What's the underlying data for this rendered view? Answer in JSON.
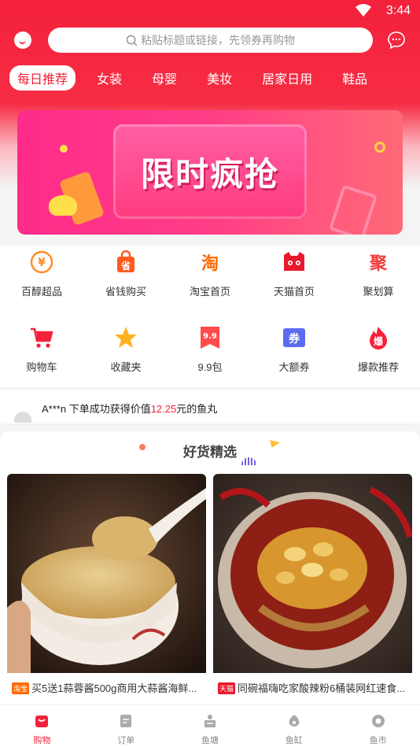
{
  "status": {
    "time": "3:44"
  },
  "search": {
    "placeholder": "粘贴标题或链接，先领券再购物"
  },
  "categories": [
    "每日推荐",
    "女装",
    "母婴",
    "美妆",
    "居家日用",
    "鞋品"
  ],
  "banner": {
    "text": "限时疯抢"
  },
  "grid": [
    {
      "label": "百醇超品",
      "icon": "yen-coin-icon",
      "glyph": "¥",
      "color": "#ff8a1f"
    },
    {
      "label": "省钱购买",
      "icon": "shopping-bag-icon",
      "glyph": "省",
      "color": "#ff5a1f"
    },
    {
      "label": "淘宝首页",
      "icon": "taobao-icon",
      "glyph": "淘",
      "color": "#ff6a00"
    },
    {
      "label": "天猫首页",
      "icon": "tmall-icon",
      "glyph": "猫",
      "color": "#e8192c"
    },
    {
      "label": "聚划算",
      "icon": "juhuasuan-icon",
      "glyph": "聚",
      "color": "#f23a3a"
    },
    {
      "label": "购物车",
      "icon": "cart-icon",
      "glyph": "",
      "color": "#f4213b"
    },
    {
      "label": "收藏夹",
      "icon": "star-icon",
      "glyph": "★",
      "color": "#ffb21f"
    },
    {
      "label": "9.9包",
      "icon": "nine-nine-icon",
      "glyph": "9.9",
      "color": "#ff4b4b"
    },
    {
      "label": "大额券",
      "icon": "coupon-icon",
      "glyph": "券",
      "color": "#5b6cf0"
    },
    {
      "label": "爆款推荐",
      "icon": "hot-fire-icon",
      "glyph": "爆",
      "color": "#f4213b"
    }
  ],
  "ticker": {
    "prefix": "A***n 下单成功获得价值",
    "amount": "12.25",
    "suffix": "元的鱼丸"
  },
  "section": {
    "title": "好货精选"
  },
  "products": [
    {
      "badge": "淘宝",
      "title": "买5送1蒜蓉酱500g商用大蒜酱海鲜..."
    },
    {
      "badge": "天猫",
      "title": "同碗福嗨吃家酸辣粉6桶装网红速食..."
    }
  ],
  "tabs": [
    {
      "label": "购物",
      "icon": "shopping-bag-icon",
      "active": true
    },
    {
      "label": "订单",
      "icon": "order-icon",
      "active": false
    },
    {
      "label": "鱼塘",
      "icon": "fish-pond-icon",
      "active": false
    },
    {
      "label": "鱼缸",
      "icon": "fish-tank-icon",
      "active": false
    },
    {
      "label": "鱼市",
      "icon": "fish-market-icon",
      "active": false
    }
  ],
  "colors": {
    "brand": "#f4213b"
  }
}
